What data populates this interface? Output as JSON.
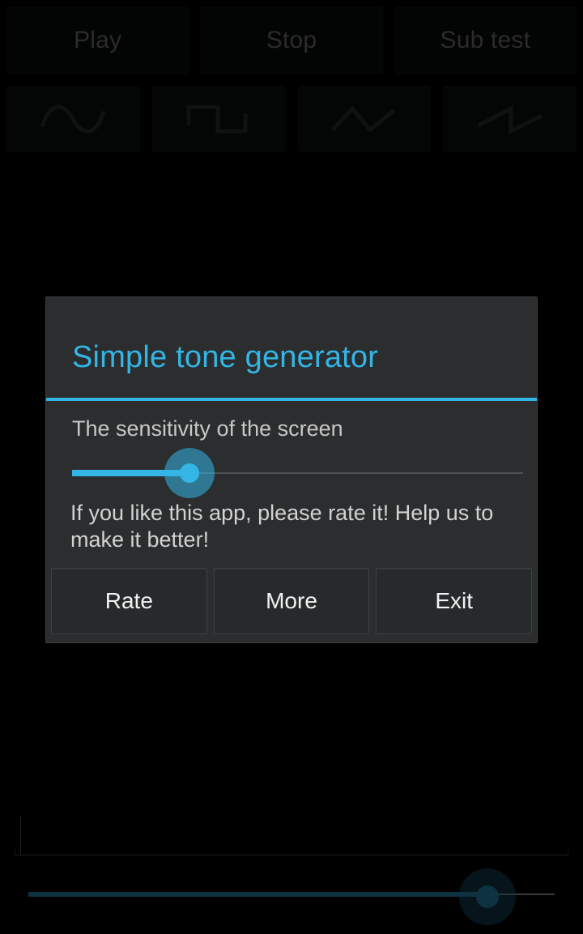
{
  "app": {
    "transport_buttons": [
      {
        "label": "Play",
        "name": "play-button"
      },
      {
        "label": "Stop",
        "name": "stop-button"
      },
      {
        "label": "Sub test",
        "name": "sub-test-button"
      }
    ],
    "waveform_buttons": [
      {
        "icon": "sine-wave-icon",
        "label": "Sine"
      },
      {
        "icon": "square-wave-icon",
        "label": "Square"
      },
      {
        "icon": "triangle-wave-icon",
        "label": "Triangle"
      },
      {
        "icon": "sawtooth-wave-icon",
        "label": "Sawtooth"
      }
    ],
    "frequency_slider": {
      "name": "frequency-slider",
      "percent": 87
    },
    "graph": {
      "name": "waveform-graph"
    }
  },
  "dialog": {
    "title": "Simple tone generator",
    "sensitivity_label": "The sensitivity of the screen",
    "sensitivity_slider": {
      "name": "sensitivity-slider",
      "percent": 26
    },
    "rate_message": "If you like this app, please rate it! Help us to make it better!",
    "buttons": [
      {
        "label": "Rate",
        "name": "rate-button"
      },
      {
        "label": "More",
        "name": "more-button"
      },
      {
        "label": "Exit",
        "name": "exit-button"
      }
    ]
  },
  "colors": {
    "accent": "#33b5e5",
    "dialog_background": "#2b2d2e",
    "screen_background": "#000000",
    "button_text": "#f2f2f2",
    "muted_text": "#9a9a9a"
  }
}
